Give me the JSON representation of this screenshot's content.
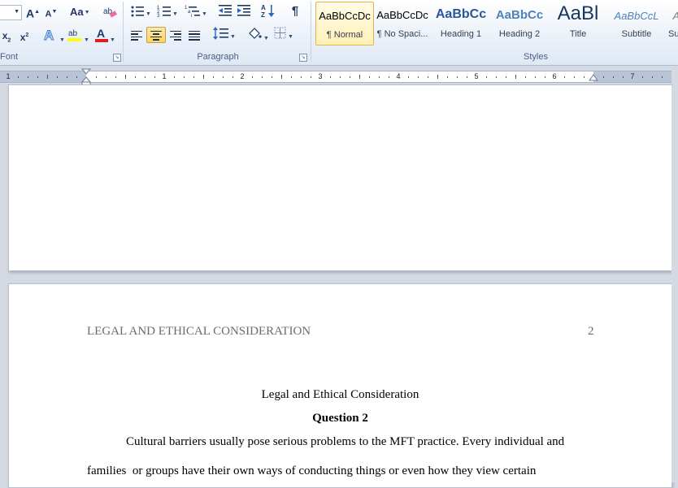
{
  "ribbon": {
    "font_group": {
      "label": "Font",
      "grow_font": "A",
      "shrink_font": "A",
      "change_case": "Aa",
      "subscript": "x",
      "superscript": "x",
      "text_highlight": "ab",
      "font_color": "A"
    },
    "paragraph_group": {
      "label": "Paragraph",
      "pilcrow": "¶"
    },
    "styles_group": {
      "label": "Styles",
      "items": [
        {
          "sample": "AaBbCcDc",
          "name": "¶ Normal",
          "selected": true
        },
        {
          "sample": "AaBbCcDc",
          "name": "¶ No Spaci...",
          "selected": false
        },
        {
          "sample": "AaBbCc",
          "name": "Heading 1",
          "selected": false
        },
        {
          "sample": "AaBbCc",
          "name": "Heading 2",
          "selected": false
        },
        {
          "sample": "AaBl",
          "name": "Title",
          "selected": false
        },
        {
          "sample": "AaBbCcL",
          "name": "Subtitle",
          "selected": false
        },
        {
          "sample": "AaBbCcL",
          "name": "Su",
          "selected": false
        }
      ]
    }
  },
  "ruler": {
    "numbers": [
      "1",
      "1",
      "2",
      "3",
      "4",
      "5",
      "6",
      "7"
    ]
  },
  "document": {
    "page2": {
      "header_text": "LEGAL AND ETHICAL CONSIDERATION",
      "page_number": "2",
      "title": "Legal and Ethical Consideration",
      "heading": "Question 2",
      "para_line1": "Cultural barriers usually pose serious problems to the MFT practice. Every individual and",
      "para_line2": "families  or groups have their own ways of conducting things or even how they view certain"
    }
  }
}
